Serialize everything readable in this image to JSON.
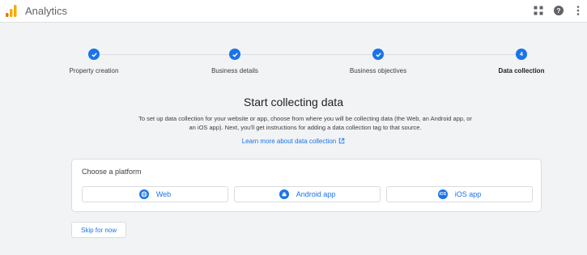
{
  "app": {
    "title": "Analytics",
    "brand_color": "#f9ab00",
    "accent_color": "#1a73e8"
  },
  "topbar_icons": [
    "apps-grid-icon",
    "help-icon",
    "more-vert-icon"
  ],
  "stepper": {
    "steps": [
      {
        "label": "Property creation",
        "status": "complete"
      },
      {
        "label": "Business details",
        "status": "complete"
      },
      {
        "label": "Business objectives",
        "status": "complete"
      },
      {
        "label": "Data collection",
        "status": "current",
        "number": "4"
      }
    ]
  },
  "main": {
    "heading": "Start collecting data",
    "description": "To set up data collection for your website or app, choose from where you will be collecting data (the Web, an Android app, or an iOS app). Next, you'll get instructions for adding a data collection tag to that source.",
    "learn_more": "Learn more about data collection"
  },
  "platform": {
    "title": "Choose a platform",
    "options": [
      {
        "label": "Web",
        "icon": "globe-icon"
      },
      {
        "label": "Android app",
        "icon": "android-icon"
      },
      {
        "label": "iOS app",
        "icon": "ios-icon",
        "icon_text": "iOS"
      }
    ]
  },
  "skip_label": "Skip for now"
}
